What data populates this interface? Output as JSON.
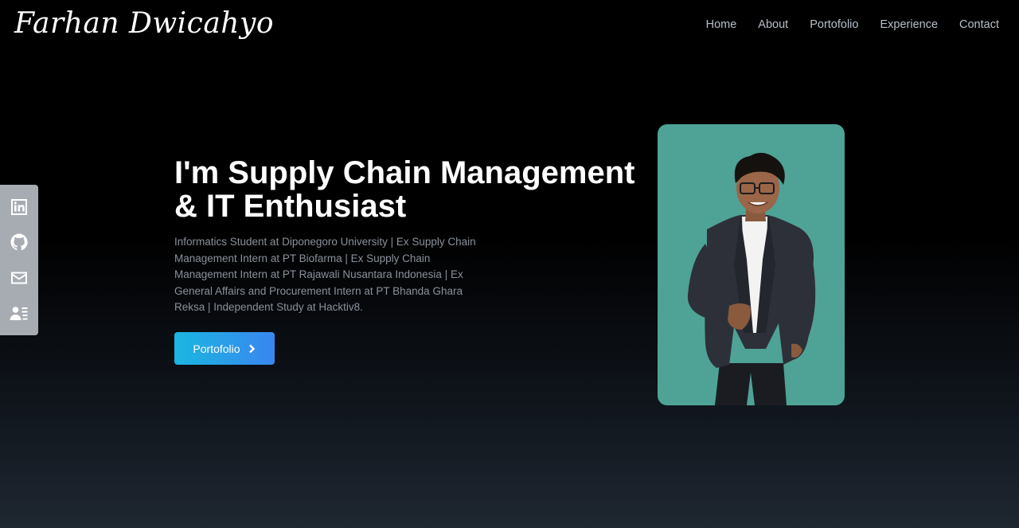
{
  "brand": {
    "logo_text": "Farhan Dwicahyo"
  },
  "nav": {
    "items": [
      {
        "label": "Home"
      },
      {
        "label": "About"
      },
      {
        "label": "Portofolio"
      },
      {
        "label": "Experience"
      },
      {
        "label": "Contact"
      }
    ]
  },
  "social": {
    "icons": [
      "linkedin-icon",
      "github-icon",
      "mail-icon",
      "resume-icon"
    ]
  },
  "hero": {
    "title": "I'm Supply Chain Management & IT Enthusiast",
    "description": "Informatics Student at Diponegoro University | Ex Supply Chain Management Intern at PT Biofarma | Ex Supply Chain Management Intern at PT Rajawali Nusantara Indonesia | Ex General Affairs and Procurement Intern at PT Bhanda Ghara Reksa | Independent Study at Hacktiv8.",
    "cta_label": "Portofolio"
  },
  "colors": {
    "background_top": "#000000",
    "background_bottom": "#1f2731",
    "nav_text": "#b8bfc8",
    "description_text": "#8a929c",
    "social_bar": "#a7acb3",
    "button_gradient_start": "#1ab6e0",
    "button_gradient_end": "#3a86f0",
    "photo_background": "#4fa296"
  }
}
